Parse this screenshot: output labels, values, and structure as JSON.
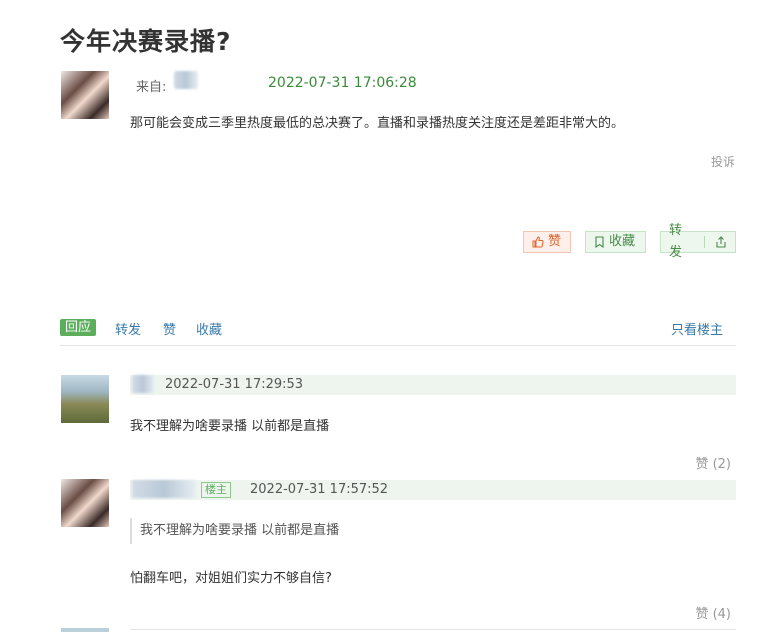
{
  "post": {
    "title": "今年决赛录播?",
    "from_label": "来自:",
    "time": "2022-07-31 17:06:28",
    "content": "那可能会变成三季里热度最低的总决赛了。直播和录播热度关注度还是差距非常大的。",
    "report": "投诉",
    "like_label": "赞",
    "favorite_label": "收藏",
    "share_label": "转发",
    "like_icon": "thumbs-up-icon",
    "favorite_icon": "bookmark-icon",
    "share_icon": "share-icon"
  },
  "toolbar": {
    "reply": "回应",
    "forward": "转发",
    "like": "赞",
    "favorite": "收藏",
    "only_host": "只看楼主"
  },
  "comments": [
    {
      "time": "2022-07-31 17:29:53",
      "text": "我不理解为啥要录播 以前都是直播",
      "likes": "赞 (2)"
    },
    {
      "host_tag": "楼主",
      "time": "2022-07-31 17:57:52",
      "quote": "我不理解为啥要录播 以前都是直播",
      "text": "怕翻车吧，对姐姐们实力不够自信?",
      "likes": "赞 (4)"
    }
  ],
  "colors": {
    "accent_green": "#5cae5c",
    "link_blue": "#3a7aa8",
    "like_orange": "#e0632f",
    "meta_bg": "#eef5ef"
  }
}
